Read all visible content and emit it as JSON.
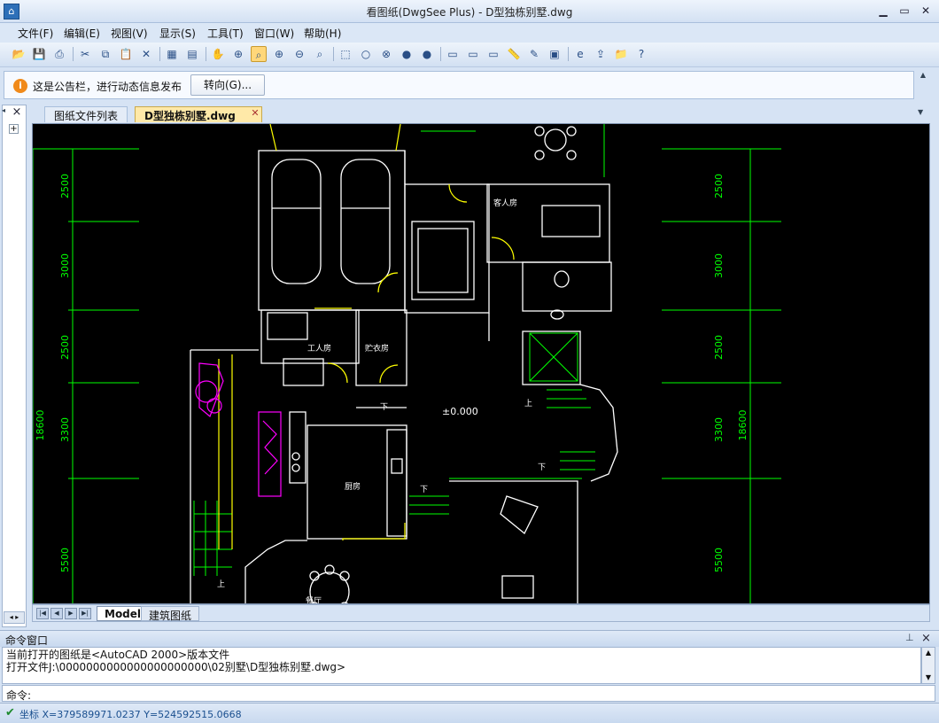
{
  "window": {
    "title": "看图纸(DwgSee Plus) - D型独栋别墅.dwg",
    "minimize": "▁",
    "maximize": "▭",
    "close": "✕"
  },
  "menu": [
    "文件(F)",
    "编辑(E)",
    "视图(V)",
    "显示(S)",
    "工具(T)",
    "窗口(W)",
    "帮助(H)"
  ],
  "toolbar": {
    "buttons": [
      "open-icon",
      "save-icon",
      "print-icon",
      "cut-icon",
      "copy-icon",
      "paste-icon",
      "delete-icon",
      "sheet-icon",
      "layout-icon",
      "pan-icon",
      "zoom-window-icon",
      "zoom-extents-icon",
      "zoom-in-icon",
      "zoom-out-icon",
      "zoom-previous-icon",
      "select-icon",
      "circle-icon",
      "circle-x-icon",
      "dot-icon",
      "dot-icon",
      "window-icon",
      "window-icon",
      "window-icon",
      "measure-icon",
      "markup-icon",
      "properties-icon",
      "ie-icon",
      "export-icon",
      "folder-icon",
      "help-icon"
    ],
    "active_index": 11
  },
  "notice": {
    "text": "这是公告栏，进行动态信息发布",
    "goto_button": "转向(G)..."
  },
  "tabs": {
    "list": "图纸文件列表",
    "drawing": "D型独栋别墅.dwg"
  },
  "drawing": {
    "dims_left": [
      "2500",
      "3000",
      "2500",
      "3300",
      "5500"
    ],
    "dims_right": [
      "2500",
      "3000",
      "2500",
      "3300",
      "5500"
    ],
    "total_left": "18600",
    "total_right": "18600",
    "elevation": "±0.000",
    "rooms": {
      "guest": "客人房",
      "worker": "工人房",
      "storage": "贮衣房",
      "kitchen": "厨房",
      "dining": "餐厅"
    },
    "stair_labels": [
      "上",
      "下",
      "下",
      "下",
      "上"
    ]
  },
  "sheets": {
    "model": "Model",
    "arch": "建筑图纸"
  },
  "command": {
    "title": "命令窗口",
    "lines": [
      "当前打开的图纸是<AutoCAD 2000>版本文件",
      "打开文件J:\\0000000000000000000000\\02别墅\\D型独栋别墅.dwg>"
    ],
    "prompt": "命令:",
    "input_value": ""
  },
  "status": {
    "coords": "坐标 X=379589971.0237 Y=524592515.0668"
  },
  "colors": {
    "canvas": "#000000",
    "cad_green": "#00ff00",
    "cad_white": "#ffffff",
    "cad_yellow": "#ffff00",
    "cad_magenta": "#ff00ff"
  }
}
